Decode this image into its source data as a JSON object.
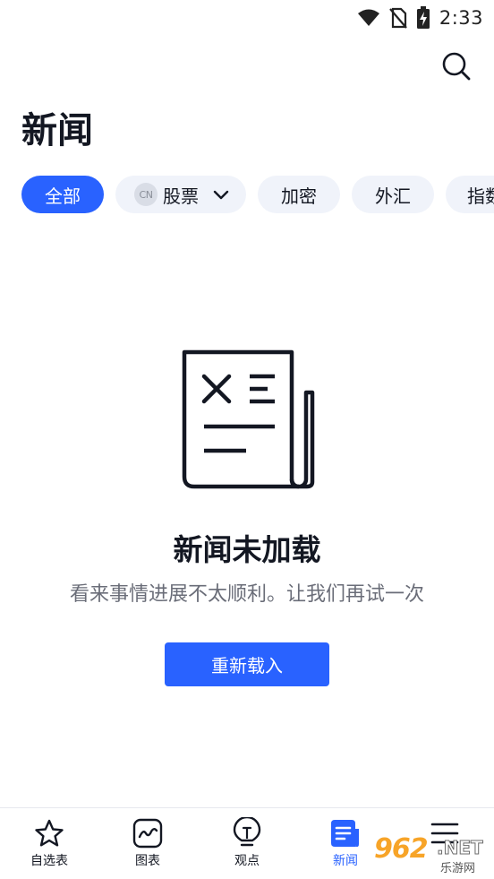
{
  "status_bar": {
    "time": "2:33",
    "icons": [
      "wifi-icon",
      "no-sim-icon",
      "battery-charging-icon"
    ]
  },
  "header": {
    "title": "新闻",
    "search_icon": "search-icon"
  },
  "filters": {
    "all": "全部",
    "stock_badge": "CN",
    "stock": "股票",
    "crypto": "加密",
    "forex": "外汇",
    "index": "指数",
    "active": "全部"
  },
  "empty_state": {
    "icon": "newspaper-error-icon",
    "title": "新闻未加载",
    "description": "看来事情进展不太顺利。让我们再试一次",
    "button": "重新载入"
  },
  "bottom_nav": {
    "items": [
      {
        "label": "自选表",
        "icon": "star-icon"
      },
      {
        "label": "图表",
        "icon": "chart-icon"
      },
      {
        "label": "观点",
        "icon": "lightbulb-icon"
      },
      {
        "label": "新闻",
        "icon": "news-icon",
        "active": true
      },
      {
        "label": "",
        "icon": "menu-icon"
      }
    ]
  },
  "watermark": {
    "number": "962",
    "suffix": ".NET",
    "sub": "乐游网"
  },
  "colors": {
    "accent": "#2962ff",
    "chip_bg": "#f0f3fa",
    "text": "#131722",
    "muted_text": "#6a6d78"
  }
}
